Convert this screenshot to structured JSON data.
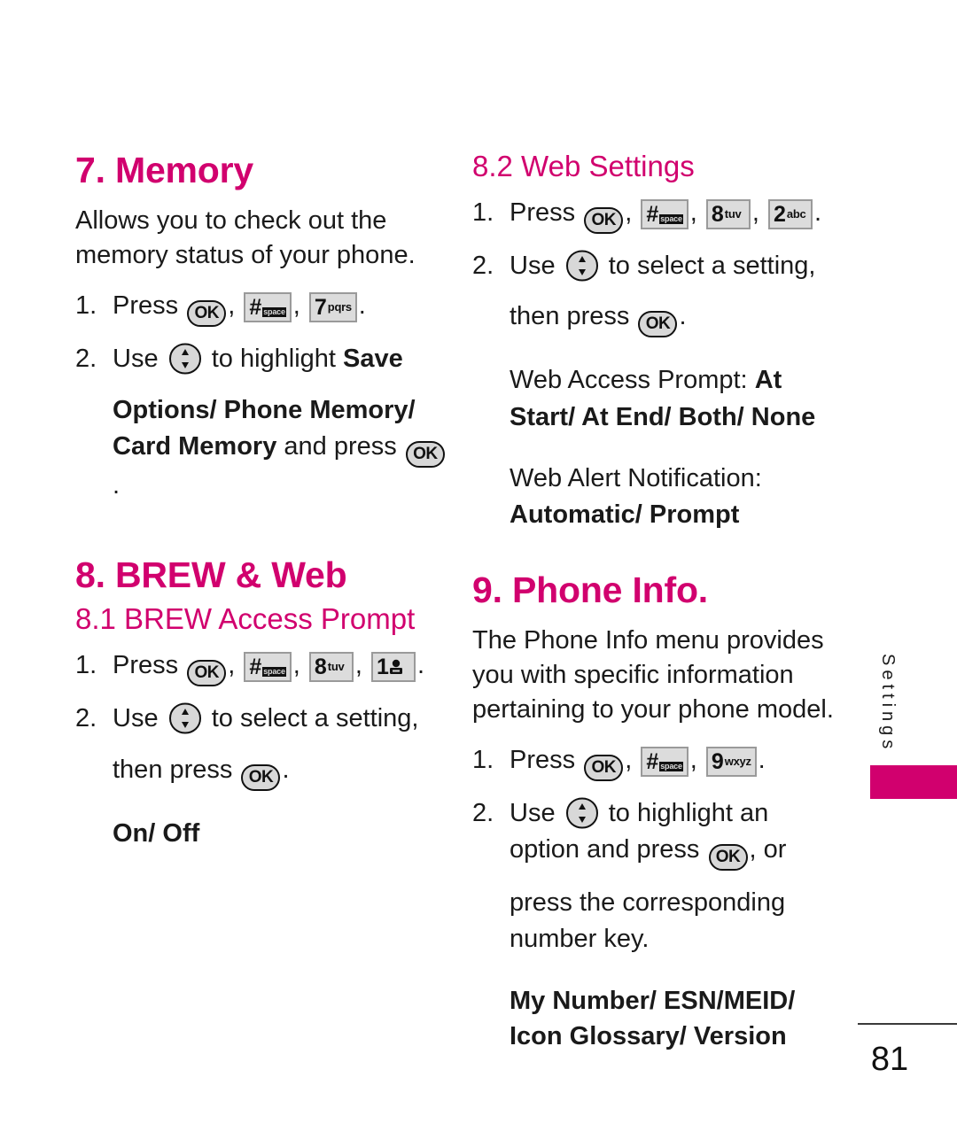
{
  "page": {
    "number": "81",
    "side_tab_label": "Settings",
    "accent_color": "#d1006e",
    "text_color": "#1a1a1a"
  },
  "keys": {
    "ok": "OK",
    "hash": {
      "digit": "#",
      "sub": "space",
      "icon": "lock-icon"
    },
    "seven": {
      "digit": "7",
      "sub": "pqrs"
    },
    "eight": {
      "digit": "8",
      "sub": "tuv"
    },
    "nine": {
      "digit": "9",
      "sub": "wxyz"
    },
    "two": {
      "digit": "2",
      "sub": "abc"
    },
    "one": {
      "digit": "1",
      "sub": "",
      "icon": "voicemail-icon"
    },
    "nav": "navigation-up-down-key"
  },
  "left_column": {
    "memory": {
      "heading": "7. Memory",
      "intro": "Allows you to check out the memory status of your phone.",
      "step1_num": "1.",
      "step1_pre": "Press",
      "step1_comma1": ",",
      "step1_comma2": ",",
      "step1_period": ".",
      "step2_num": "2.",
      "step2_pre": "Use",
      "step2_mid": "to highlight",
      "step2_bold_inline": "Save",
      "step2_bold_rest": "Options/ Phone Memory/ Card Memory",
      "step2_tail": "and press",
      "step2_period": "."
    },
    "brew_web": {
      "heading": "8. BREW & Web"
    },
    "brew_access_prompt": {
      "heading": "8.1 BREW Access Prompt",
      "step1_num": "1.",
      "step1_pre": "Press",
      "step1_comma1": ",",
      "step1_comma2": ",",
      "step1_comma3": ",",
      "step1_period": ".",
      "step2_num": "2.",
      "step2_pre": "Use",
      "step2_mid": "to select a setting,",
      "step2_cont": "then press",
      "step2_period": ".",
      "options": "On/ Off"
    }
  },
  "right_column": {
    "web_settings": {
      "heading": "8.2 Web Settings",
      "step1_num": "1.",
      "step1_pre": "Press",
      "step1_comma1": ",",
      "step1_comma2": ",",
      "step1_comma3": ",",
      "step1_period": ".",
      "step2_num": "2.",
      "step2_pre": "Use",
      "step2_mid": "to select a setting,",
      "step2_cont": "then press",
      "step2_period": ".",
      "setting1_label": "Web Access Prompt:",
      "setting1_values": "At Start/ At End/ Both/ None",
      "setting2_label": "Web Alert Notification:",
      "setting2_values": "Automatic/ Prompt"
    },
    "phone_info": {
      "heading": "9. Phone Info.",
      "intro": "The Phone Info menu provides you with specific information pertaining to your phone model.",
      "step1_num": "1.",
      "step1_pre": "Press",
      "step1_comma1": ",",
      "step1_comma2": ",",
      "step1_period": ".",
      "step2_num": "2.",
      "step2_pre": "Use",
      "step2_mid": "to highlight an option and press",
      "step2_comma": ", or",
      "step2_cont": "press the corresponding number key.",
      "options": "My Number/ ESN/MEID/ Icon Glossary/ Version"
    }
  }
}
